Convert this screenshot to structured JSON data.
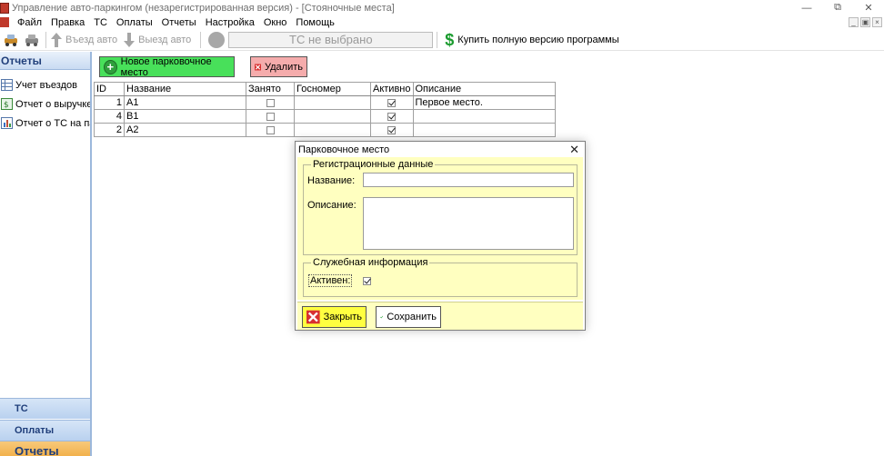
{
  "window": {
    "title": "Управление авто-паркингом (незарегистрированная версия) - [Стояночные места]"
  },
  "menu": [
    "Файл",
    "Правка",
    "ТС",
    "Оплаты",
    "Отчеты",
    "Настройка",
    "Окно",
    "Помощь"
  ],
  "toolbar": {
    "entry_label": "Въезд авто",
    "exit_label": "Выезд авто",
    "vehicle_field": "ТС не выбрано",
    "buy_label": "Купить полную версию программы"
  },
  "sidebar": {
    "header": "Отчеты",
    "items": [
      {
        "label": "Учет въездов"
      },
      {
        "label": "Отчет о выручке"
      },
      {
        "label": "Отчет о ТС на па..."
      }
    ],
    "bottom_tabs": [
      "ТС",
      "Оплаты",
      "Отчеты"
    ]
  },
  "actions": {
    "new_label": "Новое парковочное место",
    "delete_label": "Удалить"
  },
  "table": {
    "columns": [
      "ID",
      "Название",
      "Занято",
      "Госномер",
      "Активно",
      "Описание"
    ],
    "rows": [
      {
        "id": "1",
        "name": "A1",
        "busy": false,
        "plate": "",
        "active": true,
        "desc": "Первое место."
      },
      {
        "id": "4",
        "name": "B1",
        "busy": false,
        "plate": "",
        "active": true,
        "desc": ""
      },
      {
        "id": "2",
        "name": "A2",
        "busy": false,
        "plate": "",
        "active": true,
        "desc": ""
      }
    ]
  },
  "dialog": {
    "title": "Парковочное место",
    "reg_group": "Регистрационные данные",
    "name_label": "Название:",
    "name_value": "",
    "desc_label": "Описание:",
    "desc_value": "",
    "service_group": "Служебная информация",
    "active_label": "Активен:",
    "active_checked": true,
    "close_label": "Закрыть",
    "save_label": "Сохранить"
  },
  "colors": {
    "new_button": "#48e05a",
    "delete_button": "#f5acac",
    "dialog_bg": "#ffffc0",
    "close_button": "#ffff40",
    "active_tab": "#f0a83b"
  }
}
